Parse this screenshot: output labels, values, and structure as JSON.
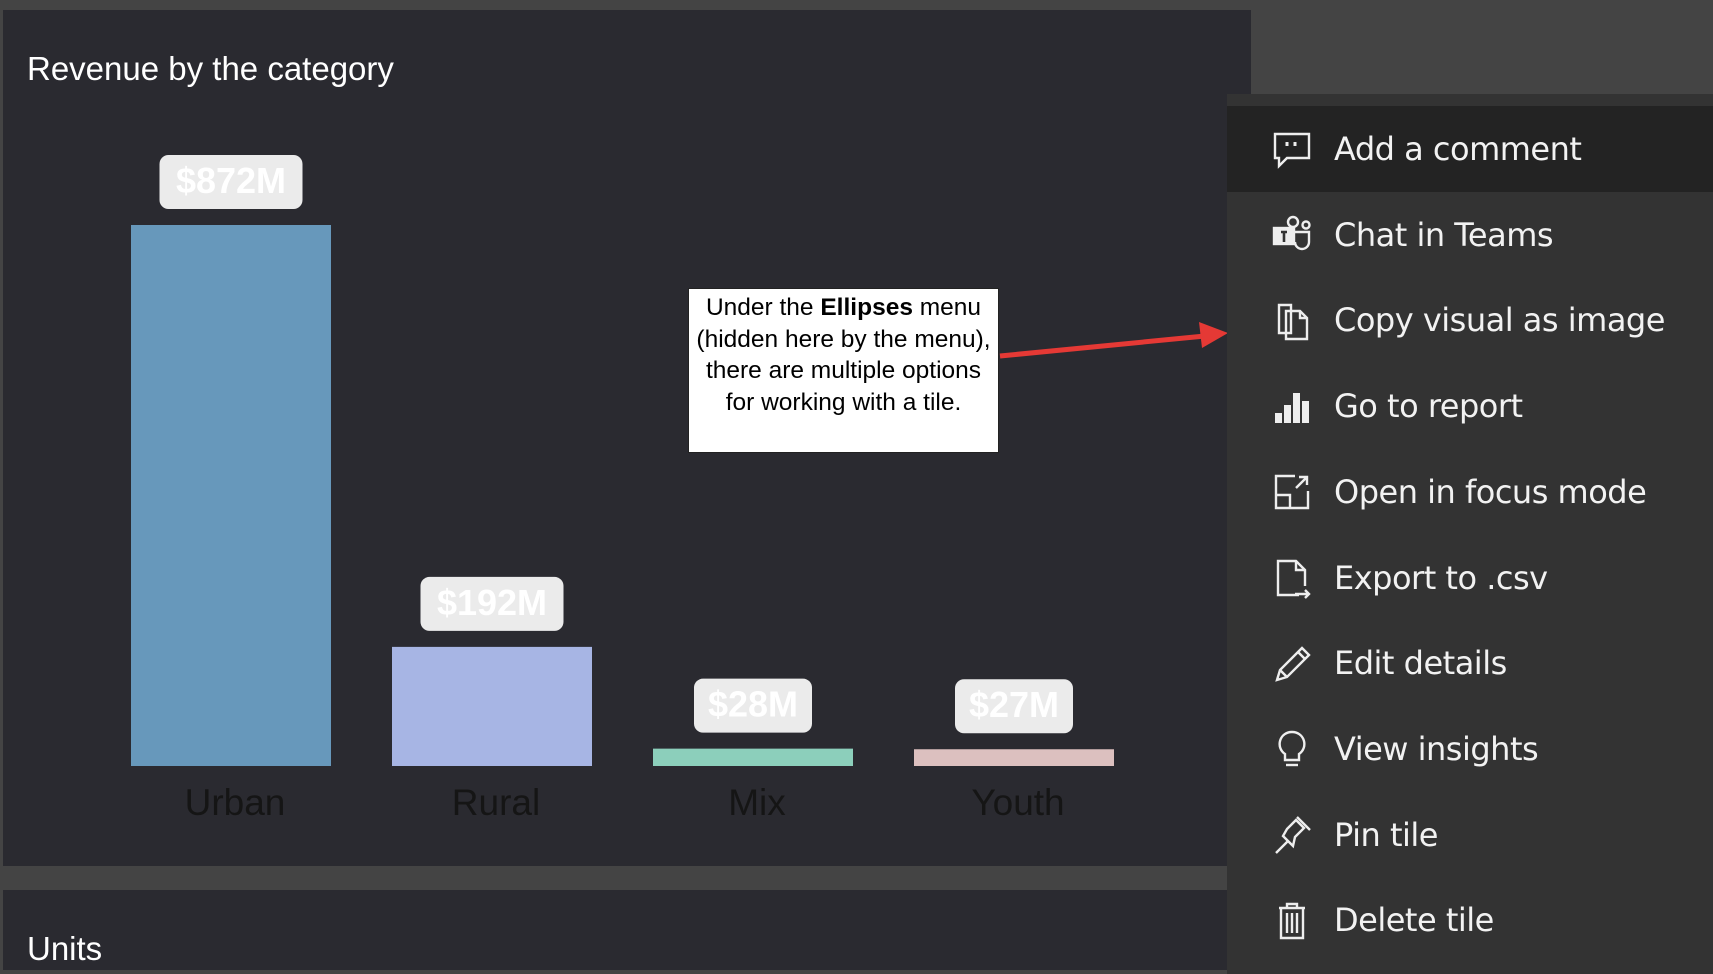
{
  "tiles": {
    "revenue_title": "Revenue by the category",
    "units_title": "Units"
  },
  "chart_data": {
    "type": "bar",
    "title": "Revenue by the category",
    "categories": [
      "Urban",
      "Rural",
      "Mix",
      "Youth"
    ],
    "values": [
      872,
      192,
      28,
      27
    ],
    "data_labels": [
      "$872M",
      "$192M",
      "$28M",
      "$27M"
    ],
    "unit": "$M",
    "colors": [
      "#6798bb",
      "#a7b5e4",
      "#8ccfbb",
      "#dcc0bf"
    ],
    "ylim": [
      0,
      872
    ],
    "grid": false,
    "legend": "none"
  },
  "callout": {
    "pre": "Under the ",
    "bold": "Ellipses",
    "post": " menu (hidden here by the menu), there are multiple options for working with a tile.",
    "arrow_color": "#e53935"
  },
  "menu": {
    "items": [
      {
        "label": "Add a comment",
        "icon": "comment-icon",
        "active": true
      },
      {
        "label": "Chat in Teams",
        "icon": "teams-icon"
      },
      {
        "label": "Copy visual as image",
        "icon": "copy-icon"
      },
      {
        "label": "Go to report",
        "icon": "bar-chart-icon"
      },
      {
        "label": "Open in focus mode",
        "icon": "focus-mode-icon"
      },
      {
        "label": "Export to .csv",
        "icon": "export-icon"
      },
      {
        "label": "Edit details",
        "icon": "pencil-icon"
      },
      {
        "label": "View insights",
        "icon": "lightbulb-icon"
      },
      {
        "label": "Pin tile",
        "icon": "pin-icon"
      },
      {
        "label": "Delete tile",
        "icon": "trash-icon"
      }
    ]
  }
}
